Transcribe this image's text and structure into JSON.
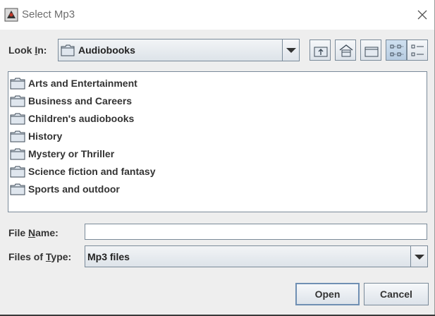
{
  "window": {
    "title": "Select Mp3",
    "app_icon": "java-duke-icon",
    "close_icon": "close-icon"
  },
  "look_in": {
    "label_prefix": "Look ",
    "label_mnemonic": "I",
    "label_suffix": "n:",
    "value": "Audiobooks",
    "folder_icon": "folder-icon"
  },
  "toolbar": {
    "buttons": [
      {
        "icon": "up-one-level-icon"
      },
      {
        "icon": "home-icon"
      },
      {
        "icon": "new-folder-icon"
      },
      {
        "icon": "list-view-icon",
        "active": true
      },
      {
        "icon": "details-view-icon"
      }
    ]
  },
  "file_list": {
    "items": [
      {
        "label": "Arts and Entertainment",
        "icon": "folder-icon"
      },
      {
        "label": "Business and Careers",
        "icon": "folder-icon"
      },
      {
        "label": "Children's audiobooks",
        "icon": "folder-icon"
      },
      {
        "label": "History",
        "icon": "folder-icon"
      },
      {
        "label": "Mystery or Thriller",
        "icon": "folder-icon"
      },
      {
        "label": "Science fiction and fantasy",
        "icon": "folder-icon"
      },
      {
        "label": "Sports and outdoor",
        "icon": "folder-icon"
      }
    ]
  },
  "file_name": {
    "label_prefix": "File ",
    "label_mnemonic": "N",
    "label_suffix": "ame:",
    "value": ""
  },
  "file_type": {
    "label_prefix": "Files of ",
    "label_mnemonic": "T",
    "label_suffix": "ype:",
    "value": "Mp3 files"
  },
  "actions": {
    "open_label": "Open",
    "cancel_label": "Cancel"
  },
  "colors": {
    "accent_border": "#7a8a99",
    "active_toolbar": "#b8cde2",
    "background": "#eeeeee"
  }
}
